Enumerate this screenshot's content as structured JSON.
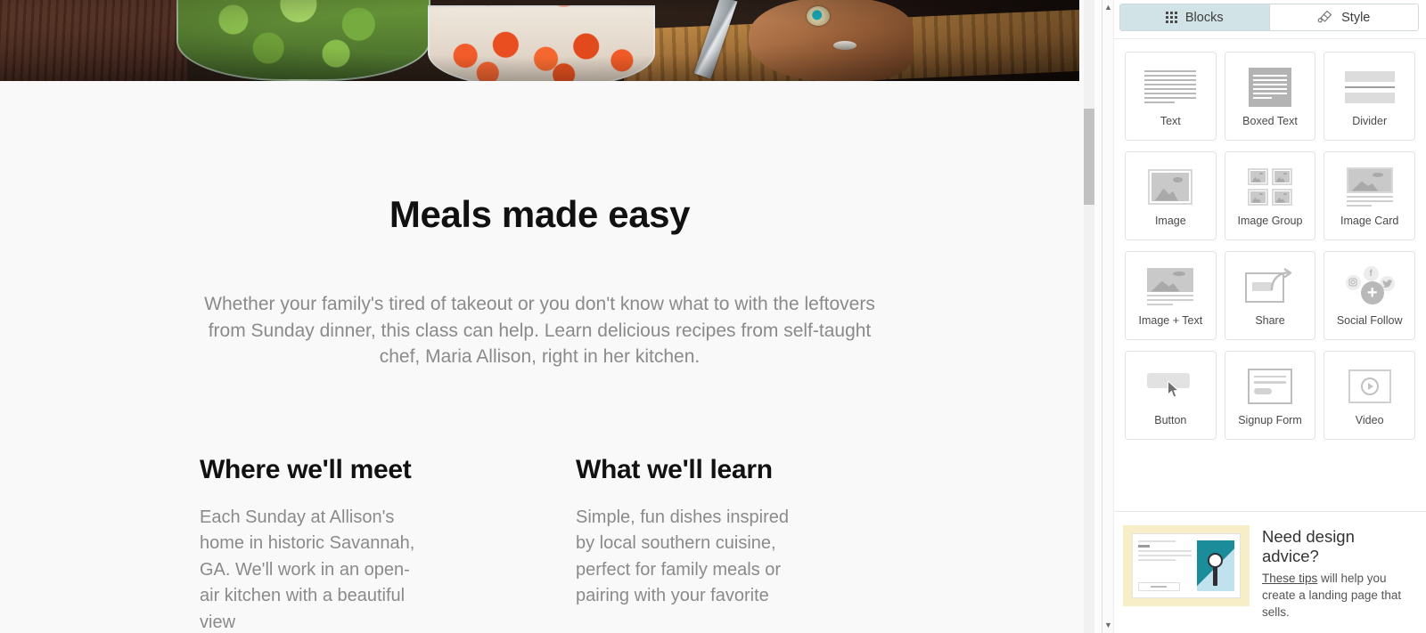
{
  "canvas": {
    "hero": {
      "alt": "hands slicing tomatoes on a wooden cutting board beside bowls of spinach and cherry tomatoes"
    },
    "headline": "Meals made easy",
    "lede": "Whether your family's tired of takeout or you don't know what to with the leftovers from Sunday dinner, this class can help. Learn delicious recipes from self-taught chef, Maria Allison, right in her kitchen.",
    "columns": [
      {
        "title": "Where we'll meet",
        "text": "Each Sunday at Allison's home in historic Savannah, GA. We'll work in an open-air kitchen with a beautiful view"
      },
      {
        "title": "What we'll learn",
        "text": "Simple, fun dishes inspired by local southern cuisine, perfect for family meals or pairing with your favorite"
      }
    ]
  },
  "panel": {
    "tabs": [
      {
        "label": "Blocks",
        "icon": "grid-dots-icon",
        "active": true
      },
      {
        "label": "Style",
        "icon": "paintbrush-icon",
        "active": false
      }
    ],
    "blocks": [
      {
        "label": "Text",
        "icon": "text-lines-icon"
      },
      {
        "label": "Boxed Text",
        "icon": "boxed-text-icon"
      },
      {
        "label": "Divider",
        "icon": "divider-icon"
      },
      {
        "label": "Image",
        "icon": "image-icon"
      },
      {
        "label": "Image Group",
        "icon": "image-group-icon"
      },
      {
        "label": "Image Card",
        "icon": "image-card-icon"
      },
      {
        "label": "Image + Text",
        "icon": "image-text-icon"
      },
      {
        "label": "Share",
        "icon": "share-arrow-icon"
      },
      {
        "label": "Social Follow",
        "icon": "social-follow-icon"
      },
      {
        "label": "Button",
        "icon": "button-cursor-icon"
      },
      {
        "label": "Signup Form",
        "icon": "signup-form-icon"
      },
      {
        "label": "Video",
        "icon": "video-play-icon"
      }
    ],
    "promo": {
      "title": "Need design advice?",
      "link_text": "These tips",
      "body_rest": " will help you create a landing page that sells.",
      "thumb_alt": "landing page preview with a wristwatch photo"
    },
    "scrollbar": {
      "up_arrow": "▲",
      "down_arrow": "▼"
    }
  },
  "colors": {
    "tab_active_bg": "#d2e3e7",
    "promo_thumb_bg": "#f7eec8",
    "promo_thumb_accent": "#1a8c9a",
    "canvas_bg": "#f9f9f9",
    "body_text": "#8a8a8a"
  }
}
